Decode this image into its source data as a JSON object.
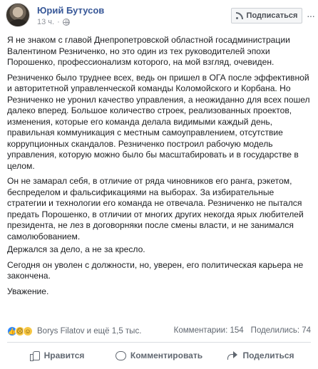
{
  "post": {
    "author": "Юрий Бутусов",
    "time": "13 ч.",
    "separator": "·",
    "subscribe_label": "Подписаться",
    "more_label": "···",
    "paragraphs": [
      "Я не знаком с главой Днепропетровской областной госадминистрации Валентином Резниченко, но это один из тех руководителей эпохи Порошенко, профессионализм которого, на мой взгляд, очевиден.",
      "Резниченко было труднее всех, ведь он пришел в ОГА после эффективной и авторитетной управленческой команды Коломойского и Корбана. Но Резниченко не уронил качество управления, а неожиданно для всех пошел далеко вперед. Большое количество строек, реализованных проектов, изменения, которые его команда делала видимыми каждый день, правильная коммуникация с местным самоуправлением, отсутствие коррупционных скандалов. Резниченко построил рабочую модель управления, которую можно было бы масштабировать и в государстве в целом.",
      "Он не замарал себя, в отличие от ряда чиновников его ранга, рэкетом, беспределом и фальсификациями на выборах. За избирательные стратегии и технологии его команда не отвечала. Резниченко не пытался предать Порошенко, в отличии от многих других некогда ярых любителей президента, не лез в договорняки после смены власти, и не занимался самолюбованием.",
      "Держался за дело, а не за кресло.",
      "Сегодня он уволен с должности, но, уверен, его политическая карьера не закончена.",
      "Уважение."
    ]
  },
  "reactions": {
    "icons": [
      "like",
      "sad",
      "haha"
    ],
    "names": "Borys Filatov и ещё 1,5 тыс.",
    "comments": "Комментарии: 154",
    "shares": "Поделились: 74"
  },
  "actions": {
    "like": "Нравится",
    "comment": "Комментировать",
    "share": "Поделиться"
  },
  "colors": {
    "link": "#385898",
    "text": "#1c1e21",
    "muted": "#606770",
    "like_blue": "#2d88ff"
  }
}
